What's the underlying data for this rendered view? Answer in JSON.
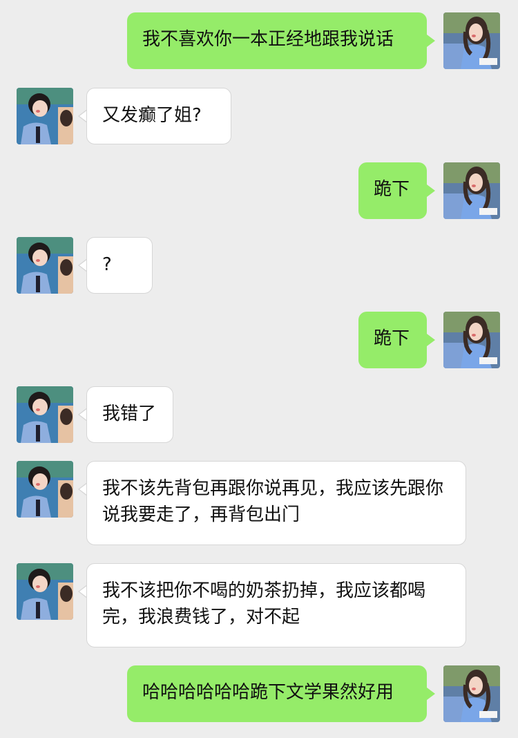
{
  "chat": {
    "messages": [
      {
        "side": "right",
        "text": "我不喜欢你一本正经地跟我说话"
      },
      {
        "side": "left",
        "text": "又发癫了姐?"
      },
      {
        "side": "right",
        "text": "跪下"
      },
      {
        "side": "left",
        "text": "?"
      },
      {
        "side": "right",
        "text": "跪下"
      },
      {
        "side": "left",
        "text": "我错了"
      },
      {
        "side": "left",
        "text": "我不该先背包再跟你说再见，我应该先跟你说我要走了，再背包出门"
      },
      {
        "side": "left",
        "text": "我不该把你不喝的奶茶扔掉，我应该都喝完，我浪费钱了，对不起"
      },
      {
        "side": "right",
        "text": "哈哈哈哈哈哈跪下文学果然好用"
      }
    ]
  },
  "colors": {
    "background": "#ededed",
    "right_bubble": "#95ec69",
    "left_bubble": "#ffffff"
  },
  "icons": {
    "self_avatar": "girl-avatar-icon",
    "other_avatar": "boy-avatar-icon"
  }
}
